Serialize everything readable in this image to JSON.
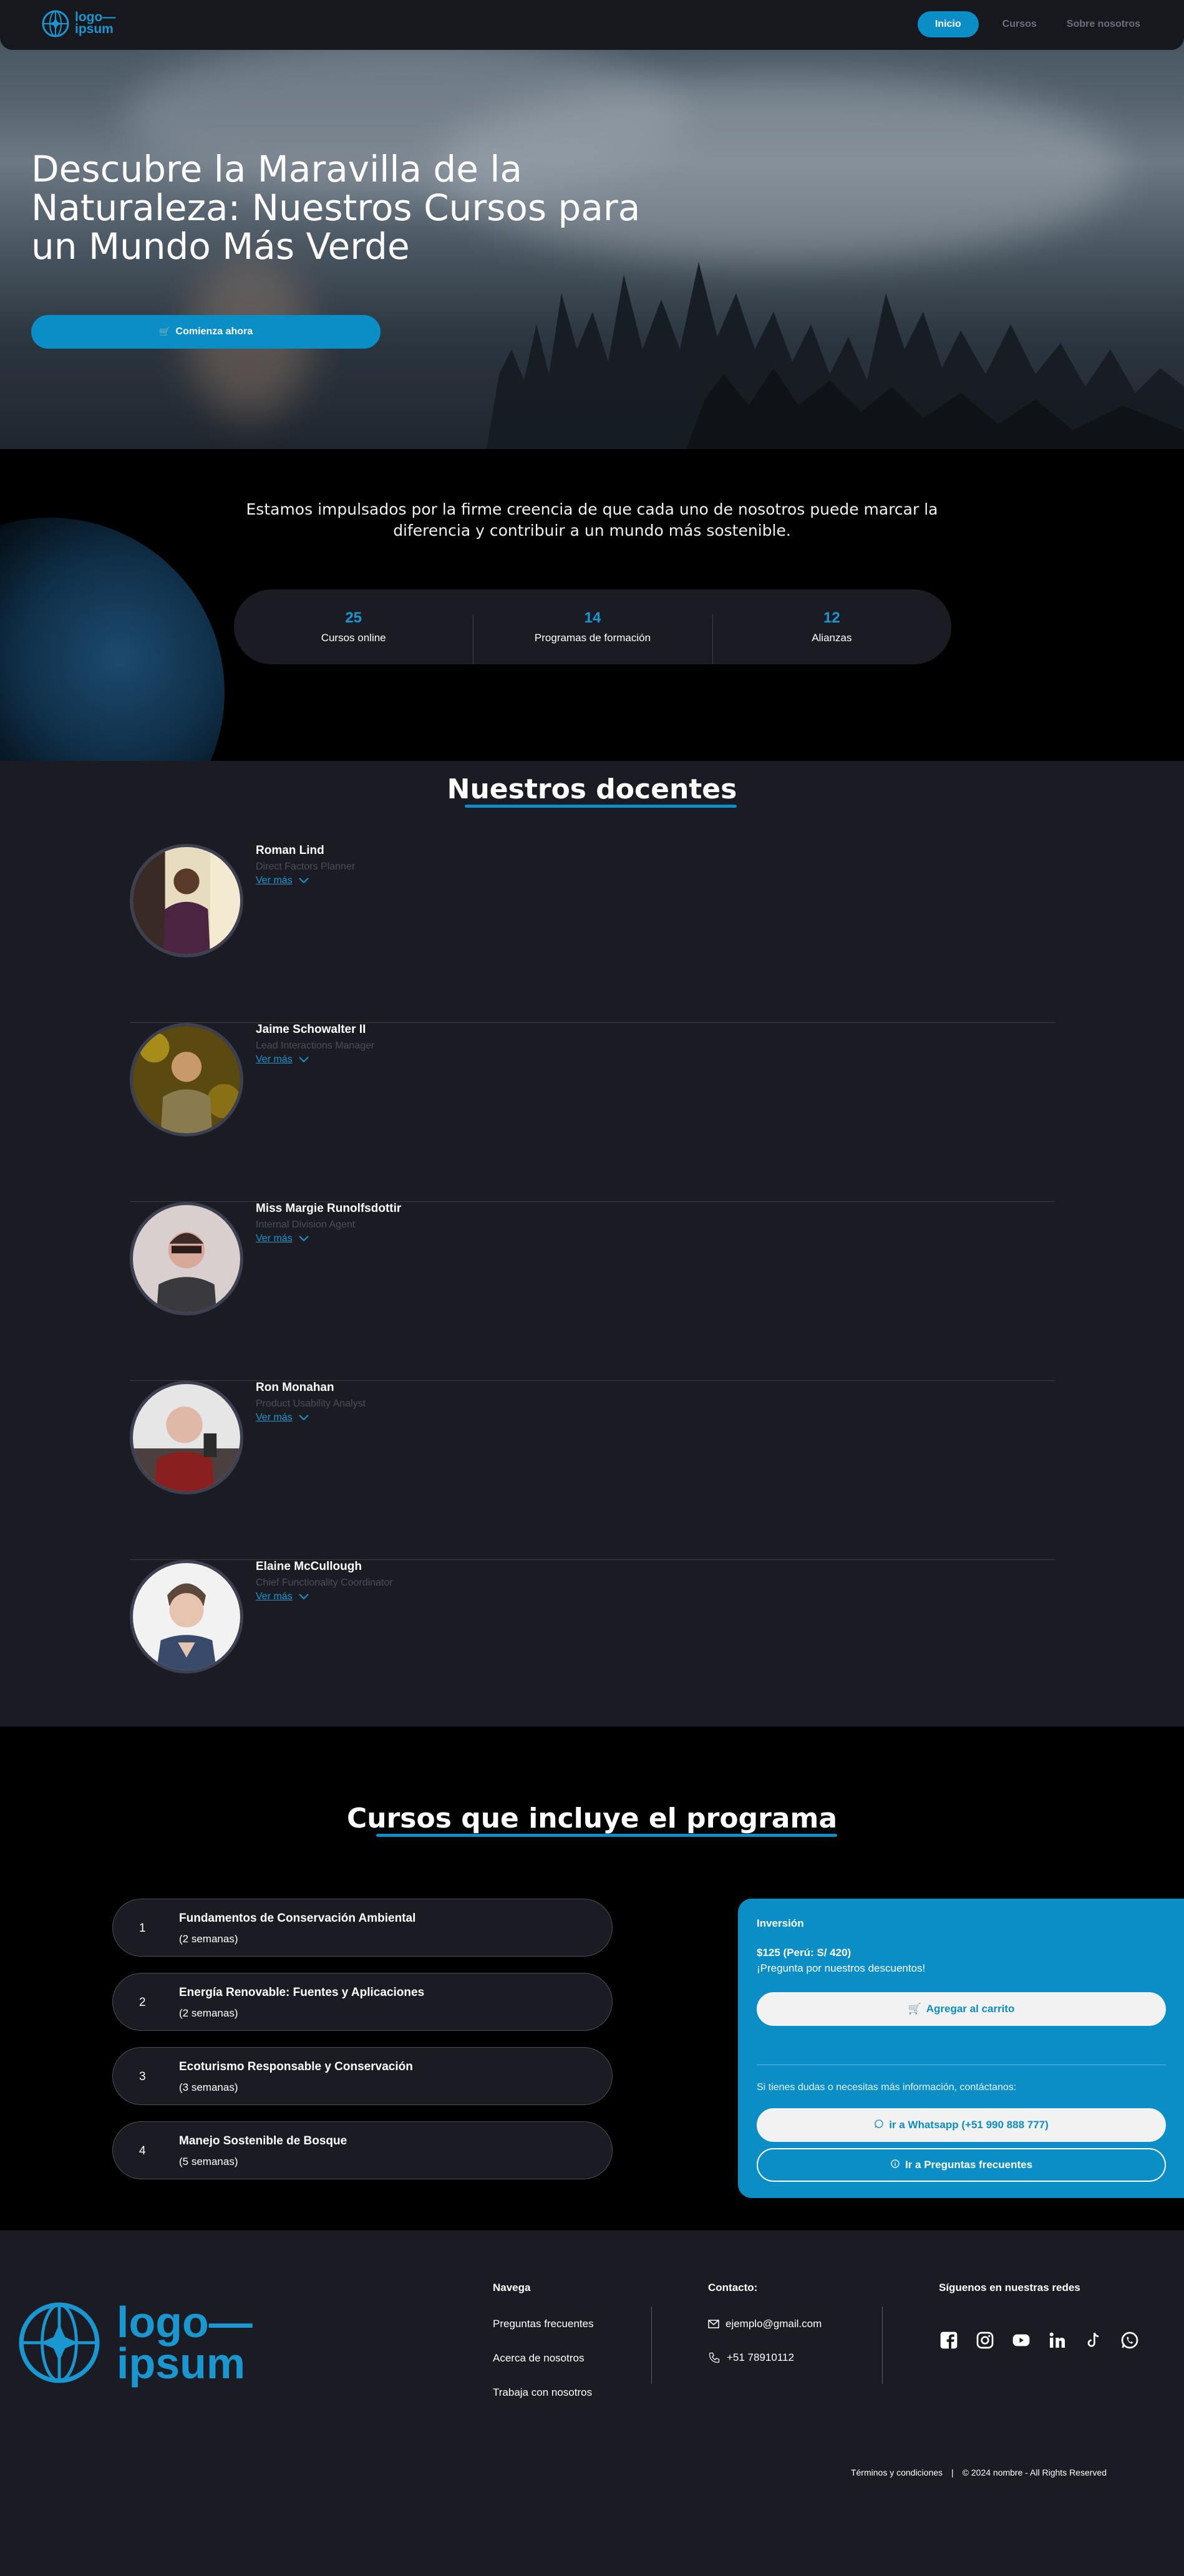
{
  "nav": {
    "logo_text": "logo—\nipsum",
    "links": [
      "Inicio",
      "Cursos",
      "Sobre nosotros"
    ]
  },
  "hero": {
    "title": "Descubre la Maravilla de la Naturaleza: Nuestros Cursos para un Mundo Más Verde",
    "cta_label": "Comienza ahora"
  },
  "about": {
    "mission": "Estamos impulsados por la firme creencia de que cada uno de nosotros puede marcar la diferencia y contribuir a un mundo más sostenible.",
    "stats": [
      {
        "value": "25",
        "label": "Cursos online"
      },
      {
        "value": "14",
        "label": "Programas de formación"
      },
      {
        "value": "12",
        "label": "Alianzas"
      }
    ]
  },
  "teachers": {
    "title": "Nuestros docentes",
    "more_label": "Ver más",
    "items": [
      {
        "name": "Roman Lind",
        "role": "Direct Factors Planner"
      },
      {
        "name": "Jaime Schowalter II",
        "role": "Lead Interactions Manager"
      },
      {
        "name": "Miss Margie Runolfsdottir",
        "role": "Internal Division Agent"
      },
      {
        "name": "Ron Monahan",
        "role": "Product Usability Analyst"
      },
      {
        "name": "Elaine McCullough",
        "role": "Chief Functionality Coordinator"
      }
    ]
  },
  "courses": {
    "title": "Cursos que incluye el programa",
    "items": [
      {
        "num": "1",
        "title": "Fundamentos de Conservación Ambiental",
        "duration": "(2 semanas)"
      },
      {
        "num": "2",
        "title": "Energía Renovable: Fuentes y Aplicaciones",
        "duration": "(2 semanas)"
      },
      {
        "num": "3",
        "title": "Ecoturismo Responsable y Conservación",
        "duration": "(3 semanas)"
      },
      {
        "num": "4",
        "title": "Manejo Sostenible de Bosque",
        "duration": "(5 semanas)"
      }
    ]
  },
  "investment": {
    "heading": "Inversión",
    "price": "$125 (Perú: S/ 420)",
    "discount_note": "¡Pregunta por nuestros descuentos!",
    "cart_label": "Agregar al carrito",
    "contact_note": "Si tienes dudas o necesitas más información, contáctanos:",
    "whatsapp_label": "ir a Whatsapp (+51 990 888 777)",
    "faq_label": "Ir a Preguntas frecuentes"
  },
  "footer": {
    "logo_text": "logo—\nipsum",
    "nav_heading": "Navega",
    "nav_links": [
      "Preguntas frecuentes",
      "Acerca de nosotros",
      "Trabaja con nosotros"
    ],
    "contact_heading": "Contacto:",
    "email": "ejemplo@gmail.com",
    "phone": "+51 78910112",
    "social_heading": "Síguenos en nuestras redes",
    "social_icons": [
      "facebook-icon",
      "instagram-icon",
      "youtube-icon",
      "linkedin-icon",
      "tiktok-icon",
      "whatsapp-icon"
    ],
    "terms": "Términos y condiciones",
    "separator": "|",
    "copyright": "© 2024 nombre - All Rights Reserved"
  },
  "colors": {
    "accent": "#0b8ec5",
    "dark": "#1b1c23",
    "black": "#000000"
  }
}
